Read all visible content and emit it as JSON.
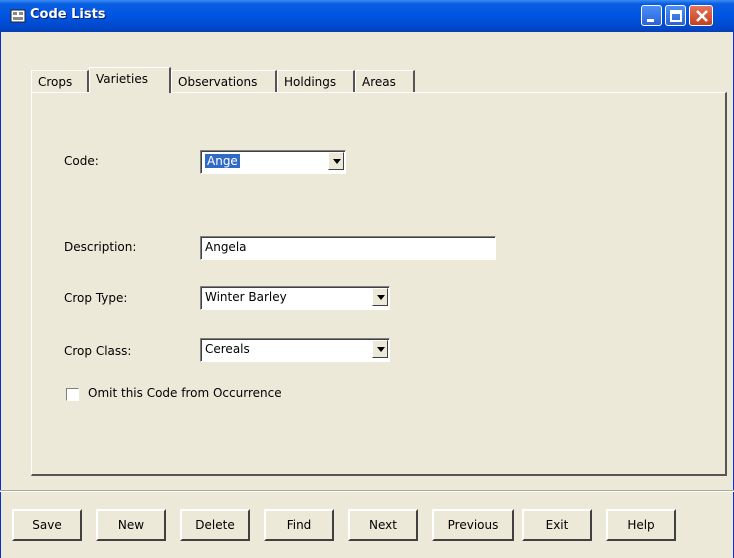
{
  "window": {
    "title": "Code Lists"
  },
  "tabs": [
    {
      "label": "Crops",
      "active": false
    },
    {
      "label": "Varieties",
      "active": true
    },
    {
      "label": "Observations",
      "active": false
    },
    {
      "label": "Holdings",
      "active": false
    },
    {
      "label": "Areas",
      "active": false
    }
  ],
  "form": {
    "code": {
      "label": "Code:",
      "value": "Ange"
    },
    "description": {
      "label": "Description:",
      "value": "Angela"
    },
    "crop_type": {
      "label": "Crop Type:",
      "value": "Winter Barley"
    },
    "crop_class": {
      "label": "Crop Class:",
      "value": "Cereals"
    },
    "omit": {
      "label": "Omit this Code from Occurrence",
      "checked": false
    }
  },
  "buttons": [
    "Save",
    "New",
    "Delete",
    "Find",
    "Next",
    "Previous",
    "Exit",
    "Help"
  ],
  "colors": {
    "titlebar": "#0054e3",
    "face": "#ece9d8",
    "selection": "#316ac5"
  }
}
